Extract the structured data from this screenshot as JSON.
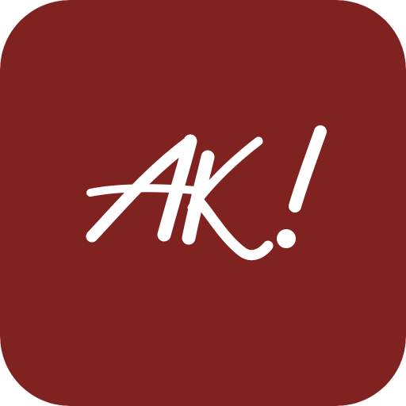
{
  "icon": {
    "logo_text": "AK!",
    "logo_icon": "script-lettermark-icon",
    "background_color": "#7F2220",
    "foreground_color": "#FFFFFF"
  }
}
